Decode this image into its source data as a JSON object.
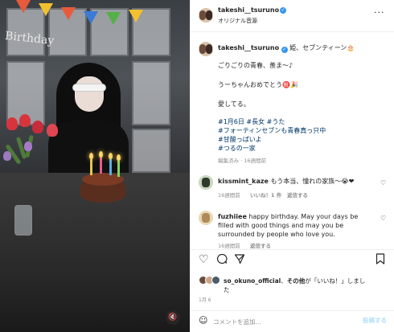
{
  "header": {
    "username": "takeshi__tsuruno",
    "audio_label": "オリジナル音源"
  },
  "caption": {
    "username": "takeshi__tsuruno",
    "title_line": "姫、セブンティーン🎂",
    "line1": "ごりごりの青春、羨ま〜♪",
    "line2": "うーちゃんおめでとう㊗️🎉",
    "line3": "愛してる。",
    "hashtags": [
      "#1月6日 #長女 #うた",
      "#フォーティンセブンも青春真っ只中",
      "#甘酸っぱいよ",
      "#つるの一家"
    ],
    "meta": "編集済み · 16週間前"
  },
  "comments": [
    {
      "username": "kissmint_kaze",
      "text": "もう本当、憧れの家族〜😭❤",
      "time": "16週間前",
      "likes": "いいね！1 件",
      "reply": "返信する"
    },
    {
      "username": "fuzhiiee",
      "line1": "happy birthday. May your days be",
      "line2": "filled with good things and may you be",
      "line3": "surrounded by people who love you.",
      "time": "16週間前",
      "reply": "返信する"
    }
  ],
  "likes_line": {
    "part1": "so_okuno_official",
    "part2": "、",
    "part3": "その他",
    "part4": "が「いいね！」しまし",
    "part5": "た"
  },
  "post_date": "1月 6",
  "composer": {
    "placeholder": "コメントを追加...",
    "post_label": "投稿する"
  },
  "photo": {
    "banner_text": "Birthday",
    "sound_icon": "🔇"
  },
  "colors": {
    "accent": "#3897f0",
    "hashtag": "#00376b",
    "post_disabled": "#b2dffc",
    "meta": "#8e8e8e"
  },
  "icons": [
    "verified-icon",
    "more-icon",
    "heart-icon",
    "comment-icon",
    "share-icon",
    "bookmark-icon",
    "emoji-icon",
    "mute-icon"
  ]
}
